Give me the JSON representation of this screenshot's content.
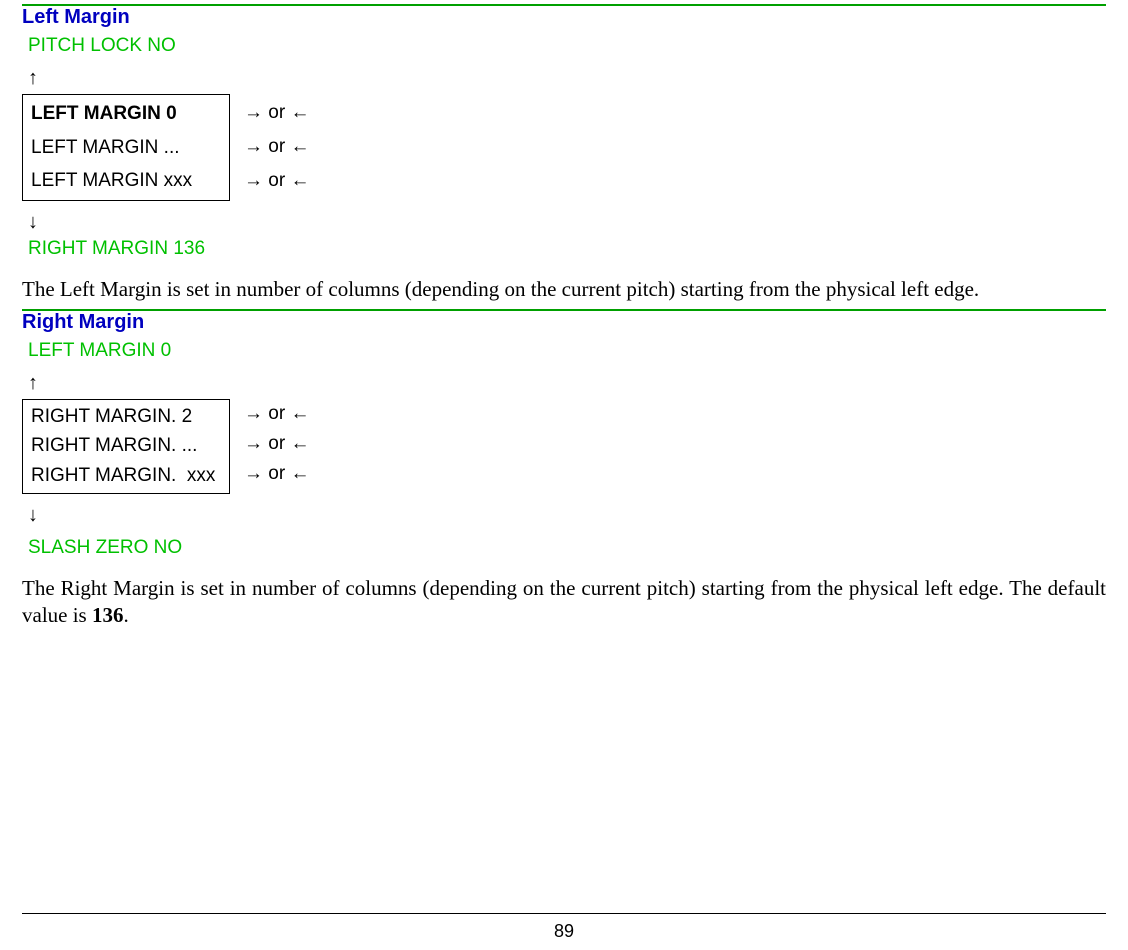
{
  "section1": {
    "heading": "Left Margin",
    "topLabel": "PITCH LOCK NO",
    "upArrow": "↑",
    "menu": {
      "row0": "LEFT MARGIN 0",
      "row1": "LEFT MARGIN ...",
      "row2": "LEFT MARGIN xxx"
    },
    "rowArrows": {
      "a0": "→ or ←",
      "a1": "→ or ←",
      "a2": "→ or ←"
    },
    "downArrow": "↓",
    "bottomLabel": "RIGHT MARGIN 136",
    "body": "The Left Margin is set in number of columns (depending on the current pitch) starting from the physical left edge."
  },
  "section2": {
    "heading": "Right Margin",
    "topLabel": "LEFT MARGIN 0",
    "upArrow": "↑",
    "menu": {
      "row0": "RIGHT MARGIN. 2",
      "row1": "RIGHT MARGIN. ...",
      "row2": "RIGHT MARGIN.  xxx"
    },
    "rowArrows": {
      "a0": "→ or ←",
      "a1": "→ or ←",
      "a2": "→ or ←"
    },
    "downArrow": "↓",
    "bottomLabel": "SLASH ZERO  NO",
    "body_pre": "The Right Margin is set in number of columns (depending on the current pitch) starting from the physical left edge. The default value is ",
    "body_bold": "136",
    "body_post": "."
  },
  "pageNumber": "89"
}
